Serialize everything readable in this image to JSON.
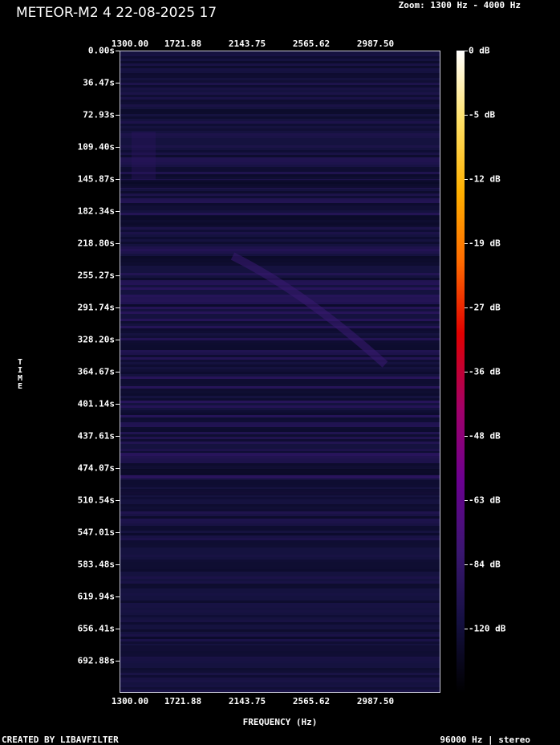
{
  "header": {
    "title": "METEOR-M2 4 22-08-2025 17",
    "zoom": "Zoom: 1300 Hz - 4000 Hz"
  },
  "x_axis": {
    "ticks": [
      "1300.00",
      "1721.88",
      "2143.75",
      "2565.62",
      "2987.50"
    ],
    "label": "FREQUENCY (Hz)"
  },
  "y_axis": {
    "ticks": [
      "0.00s",
      "36.47s",
      "72.93s",
      "109.40s",
      "145.87s",
      "182.34s",
      "218.80s",
      "255.27s",
      "291.74s",
      "328.20s",
      "364.67s",
      "401.14s",
      "437.61s",
      "474.07s",
      "510.54s",
      "547.01s",
      "583.48s",
      "619.94s",
      "656.41s",
      "692.88s"
    ],
    "label": "TIME"
  },
  "colorbar": {
    "ticks": [
      "0 dB",
      "-5 dB",
      "-12 dB",
      "-19 dB",
      "-27 dB",
      "-36 dB",
      "-48 dB",
      "-63 dB",
      "-84 dB",
      "-120 dB"
    ],
    "colors": [
      "#ffffff",
      "#ffe066",
      "#ffb000",
      "#ff6a00",
      "#e00000",
      "#a0006a",
      "#6a0090",
      "#3a1670",
      "#141040",
      "#000000"
    ]
  },
  "footer": {
    "left": "CREATED BY LIBAVFILTER",
    "right": "96000 Hz | stereo"
  },
  "spectrogram": {
    "base_color": "#15123f",
    "band_color": "#2a155e",
    "dark_band_color": "#0a0a26",
    "trail_color": "#3a1a72"
  }
}
